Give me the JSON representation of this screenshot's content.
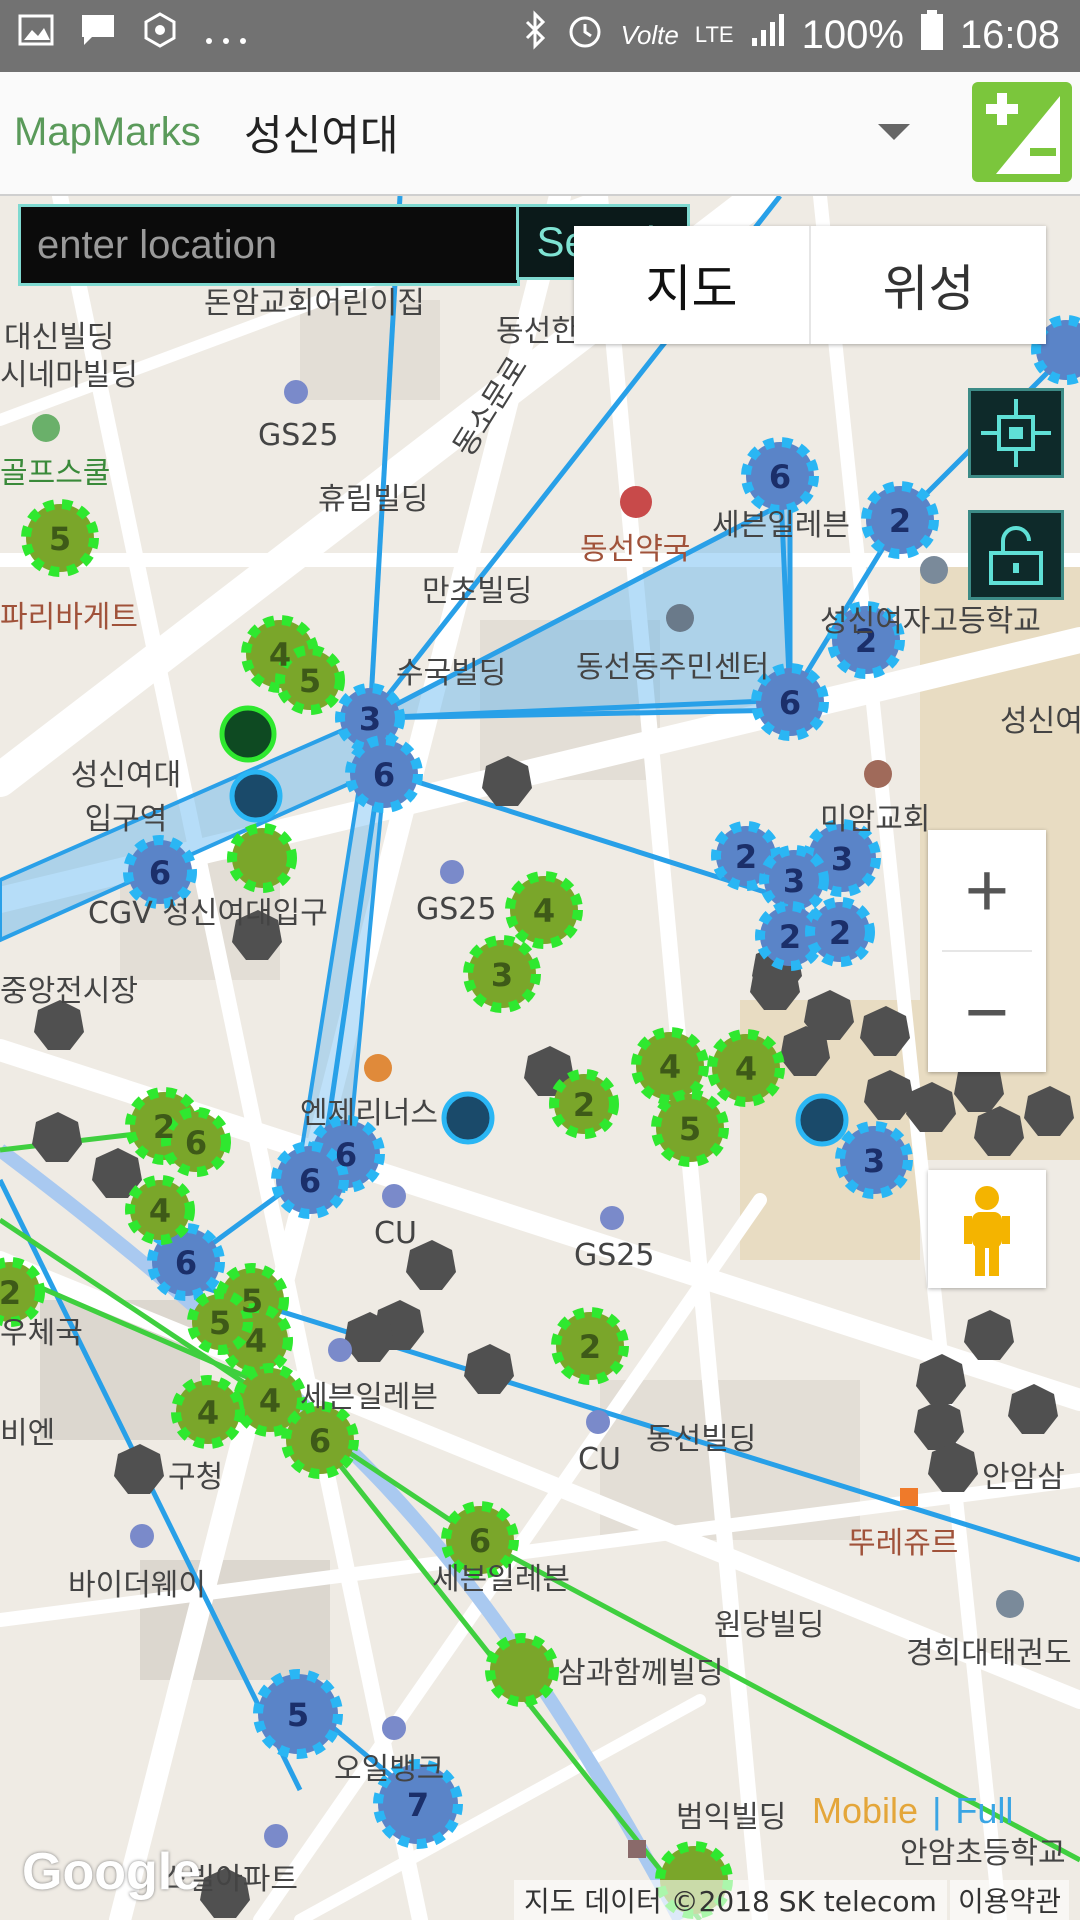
{
  "statusbar": {
    "battery": "100%",
    "time": "16:08",
    "network": "LTE",
    "left_icons": [
      "image-icon",
      "message-icon",
      "settings-icon",
      "more-icon"
    ],
    "right_icons": [
      "bluetooth-icon",
      "alarm-icon",
      "volte-icon",
      "lte-icon",
      "signal-icon",
      "battery-icon"
    ],
    "volte": "Volte"
  },
  "appbar": {
    "brand": "MapMarks",
    "location": "성신여대",
    "add_icon": "add-edit-icon"
  },
  "search": {
    "placeholder": "enter location",
    "button": "Search"
  },
  "map_type": {
    "map": "지도",
    "satellite": "위성"
  },
  "tools": {
    "target_icon": "target-icon",
    "lock_icon": "unlock-icon"
  },
  "zoom": {
    "plus": "+",
    "minus": "−"
  },
  "footer": {
    "google": "Google",
    "copyright": "지도 데이터 ©2018 SK telecom",
    "terms": "이용약관",
    "mobile": "Mobile",
    "divider": "|",
    "full": "Full"
  },
  "labels": [
    {
      "id": "l1",
      "text": "돈암교회어린이집"
    },
    {
      "id": "l2",
      "text": "동선한"
    },
    {
      "id": "l3",
      "text": "대신빌딩"
    },
    {
      "id": "l4",
      "text": "시네마빌딩"
    },
    {
      "id": "l5",
      "text": "GS25"
    },
    {
      "id": "l6",
      "text": "휴림빌딩"
    },
    {
      "id": "l7",
      "text": "동선약국"
    },
    {
      "id": "l8",
      "text": "만초빌딩"
    },
    {
      "id": "l9",
      "text": "세븐일레븐"
    },
    {
      "id": "l10",
      "text": "수국빌딩"
    },
    {
      "id": "l11",
      "text": "동선동주민센터"
    },
    {
      "id": "l12",
      "text": "성신여자고등학교"
    },
    {
      "id": "l13",
      "text": "성신여대입구역"
    },
    {
      "id": "l14",
      "text": "미암교회"
    },
    {
      "id": "l15",
      "text": "GS25"
    },
    {
      "id": "l16",
      "text": "CGV 성신여대입구"
    },
    {
      "id": "l17",
      "text": "중앙전시장"
    },
    {
      "id": "l18",
      "text": "엔제리너스"
    },
    {
      "id": "l19",
      "text": "CU"
    },
    {
      "id": "l20",
      "text": "GS25"
    },
    {
      "id": "l21",
      "text": "우체국"
    },
    {
      "id": "l22",
      "text": "세븐일레븐"
    },
    {
      "id": "l23",
      "text": "CU"
    },
    {
      "id": "l24",
      "text": "동선빌딩"
    },
    {
      "id": "l25",
      "text": "안암삼"
    },
    {
      "id": "l26",
      "text": "뚜레쥬르"
    },
    {
      "id": "l27",
      "text": "바이더웨이"
    },
    {
      "id": "l28",
      "text": "세븐일레븐"
    },
    {
      "id": "l29",
      "text": "원당빌딩"
    },
    {
      "id": "l30",
      "text": "경희대태권도"
    },
    {
      "id": "l31",
      "text": "삼과함께빌딩"
    },
    {
      "id": "l32",
      "text": "오일뱅크"
    },
    {
      "id": "l33",
      "text": "범익빌딩"
    },
    {
      "id": "l34",
      "text": "안암초등학교"
    },
    {
      "id": "l35",
      "text": "파리바게트"
    },
    {
      "id": "l36",
      "text": "골프스쿨"
    },
    {
      "id": "l37",
      "text": "동소문로"
    },
    {
      "id": "l38",
      "text": "성신여"
    },
    {
      "id": "l39",
      "text": "비엔"
    },
    {
      "id": "l40",
      "text": "구청"
    },
    {
      "id": "l41",
      "text": "스빌아파트"
    }
  ],
  "portals": [
    {
      "team": "blue",
      "level": "6"
    },
    {
      "team": "blue",
      "level": "2"
    },
    {
      "team": "blue",
      "level": "2"
    },
    {
      "team": "blue",
      "level": "6"
    },
    {
      "team": "blue",
      "level": "3"
    },
    {
      "team": "blue",
      "level": "6"
    },
    {
      "team": "blue",
      "level": "3"
    },
    {
      "team": "blue",
      "level": "2"
    },
    {
      "team": "blue",
      "level": "3"
    },
    {
      "team": "blue",
      "level": "2"
    },
    {
      "team": "blue",
      "level": "2"
    },
    {
      "team": "blue",
      "level": "6"
    },
    {
      "team": "blue",
      "level": "6"
    },
    {
      "team": "blue",
      "level": "6"
    },
    {
      "team": "blue",
      "level": "3"
    },
    {
      "team": "blue",
      "level": "5"
    },
    {
      "team": "blue",
      "level": "7"
    },
    {
      "team": "blue",
      "level": "6"
    },
    {
      "team": "green",
      "level": "5"
    },
    {
      "team": "green",
      "level": "4"
    },
    {
      "team": "green",
      "level": "5"
    },
    {
      "team": "green",
      "level": "4"
    },
    {
      "team": "green",
      "level": "3"
    },
    {
      "team": "green",
      "level": "4"
    },
    {
      "team": "green",
      "level": "2"
    },
    {
      "team": "green",
      "level": "4"
    },
    {
      "team": "green",
      "level": "5"
    },
    {
      "team": "green",
      "level": "2"
    },
    {
      "team": "green",
      "level": "5"
    },
    {
      "team": "green",
      "level": "4"
    },
    {
      "team": "green",
      "level": "4"
    },
    {
      "team": "green",
      "level": "4"
    },
    {
      "team": "green",
      "level": "6"
    },
    {
      "team": "green",
      "level": "6"
    },
    {
      "team": "green",
      "level": "2"
    },
    {
      "team": "green",
      "level": "6"
    },
    {
      "team": "green",
      "level": "4"
    },
    {
      "team": "green",
      "level": "5"
    },
    {
      "team": "green",
      "level": "2"
    }
  ]
}
